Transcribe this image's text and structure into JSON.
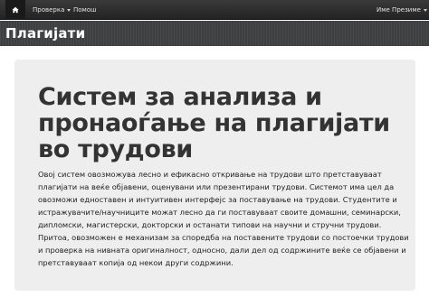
{
  "navbar": {
    "home_icon": "home-icon",
    "menu_check": "Проверка",
    "menu_help": "Помош",
    "user_menu": "Име Презиме"
  },
  "banner": {
    "title": "Плагијати"
  },
  "jumbotron": {
    "heading": "Систем за анализа и пронаоѓање на плагијати во трудови",
    "body": "Овој систем овозможува лесно и ефикасно откривање на трудови што претставуваат плагијати на веќе објавени, оценувани или презентирани трудови. Системот има цел да овозможи едноставен и интуитивен интерфејс за поставување на трудови. Студентите и истражувачите/научниците можат лесно да ги поставуваат своите домашни, семинарски, дипломски, магистерски, докторски и останати типови на научни и стручни трудови. Притоа, овозможен е механизам за споредба на поставените трудови со постоечки трудови и проверка на нивната оригиналност, односно, дали дел од содржините веќе се објавени и претставуваат копија од некои други содржини."
  }
}
